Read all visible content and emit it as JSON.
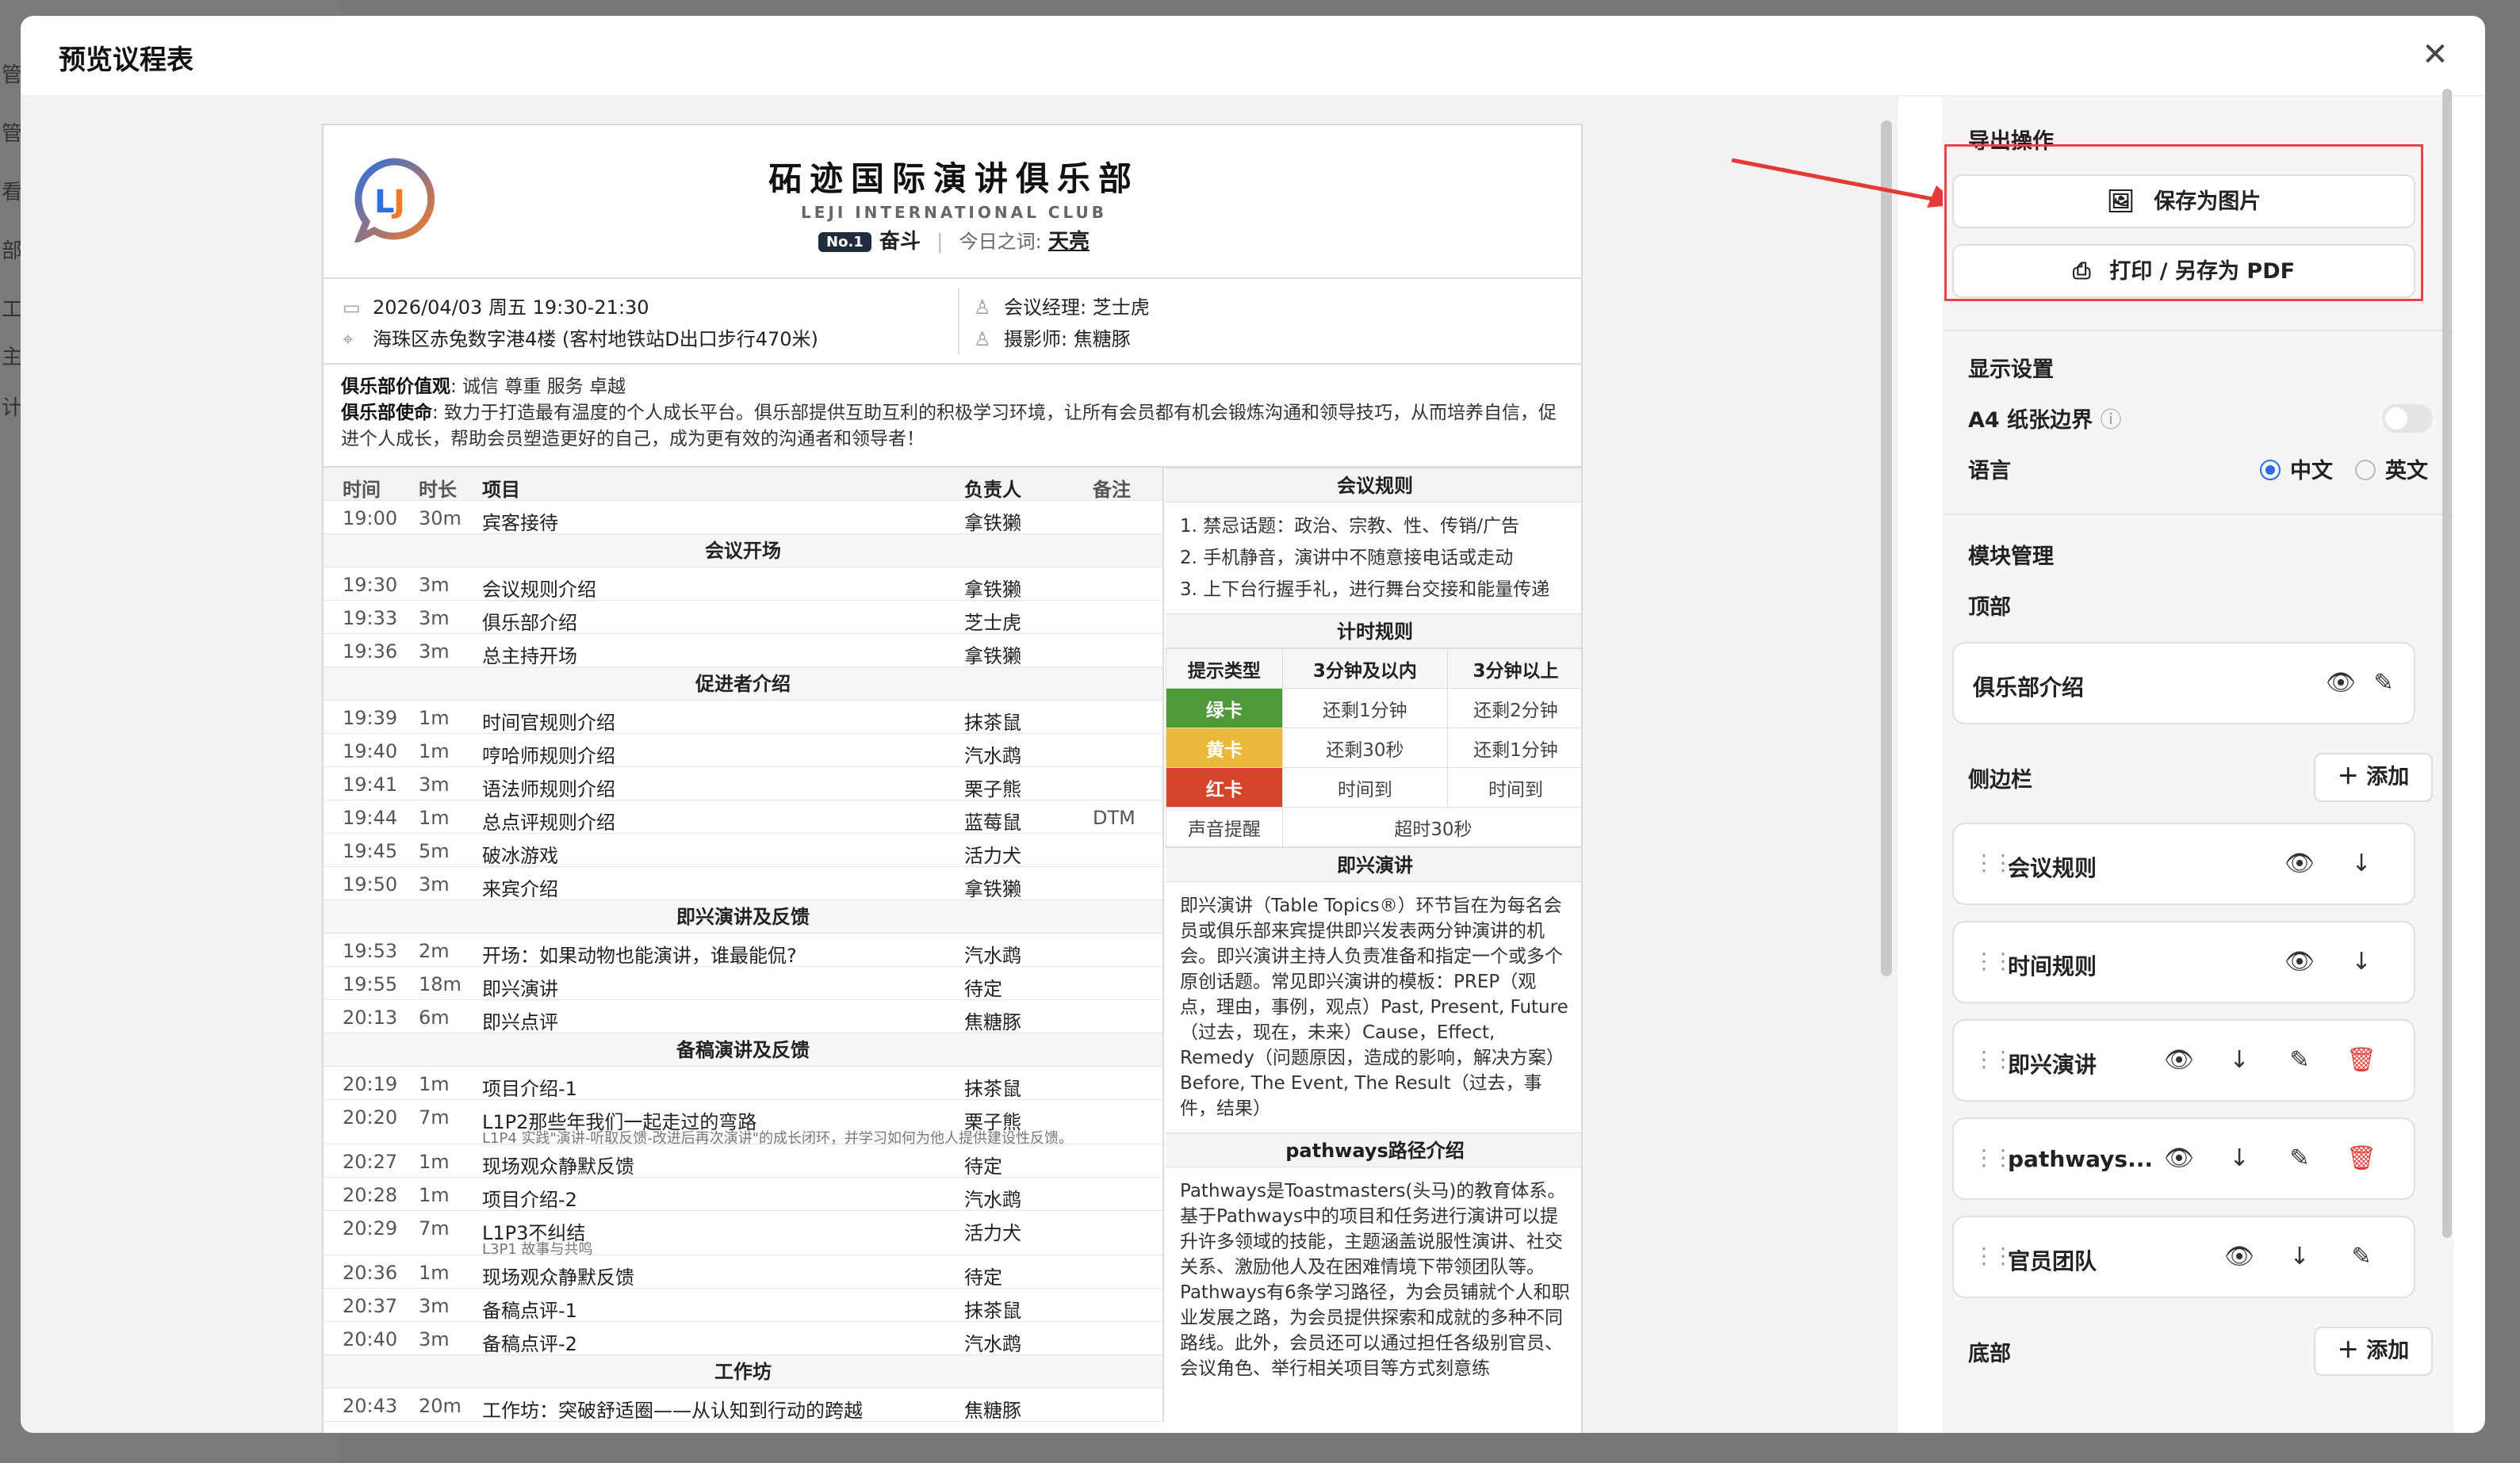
{
  "background": {
    "sidebar_fragments": [
      "管",
      "管",
      "看",
      "部",
      "工",
      "主",
      "计"
    ]
  },
  "dialog": {
    "title": "预览议程表",
    "close_icon": "✕"
  },
  "paper": {
    "club_name": "砳迹国际演讲俱乐部",
    "club_subtitle": "LEJI INTERNATIONAL CLUB",
    "meeting_no": "No.1",
    "theme": "奋斗",
    "word_label": "今日之词:",
    "word": "天亮",
    "datetime": "2026/04/03 周五 19:30-21:30",
    "location": "海珠区赤兔数字港4楼 (客村地铁站D出口步行470米)",
    "manager_label": "会议经理:",
    "manager": "芝士虎",
    "photographer_label": "摄影师:",
    "photographer": "焦糖豚",
    "values_label": "俱乐部价值观",
    "values": ": 诚信 尊重 服务 卓越",
    "mission_label": "俱乐部使命",
    "mission": ": 致力于打造最有温度的个人成长平台。俱乐部提供互助互利的积极学习环境，让所有会员都有机会锻炼沟通和领导技巧，从而培养自信，促进个人成长，帮助会员塑造更好的自己，成为更有效的沟通者和领导者！"
  },
  "agenda": {
    "headers": {
      "time": "时间",
      "duration": "时长",
      "item": "项目",
      "owner": "负责人",
      "note": "备注"
    },
    "rows": [
      {
        "type": "row",
        "time": "19:00",
        "dur": "30m",
        "item": "宾客接待",
        "owner": "拿铁獭",
        "note": ""
      },
      {
        "type": "section",
        "title": "会议开场"
      },
      {
        "type": "row",
        "time": "19:30",
        "dur": "3m",
        "item": "会议规则介绍",
        "owner": "拿铁獭",
        "note": ""
      },
      {
        "type": "row",
        "time": "19:33",
        "dur": "3m",
        "item": "俱乐部介绍",
        "owner": "芝士虎",
        "note": ""
      },
      {
        "type": "row",
        "time": "19:36",
        "dur": "3m",
        "item": "总主持开场",
        "owner": "拿铁獭",
        "note": ""
      },
      {
        "type": "section",
        "title": "促进者介绍"
      },
      {
        "type": "row",
        "time": "19:39",
        "dur": "1m",
        "item": "时间官规则介绍",
        "owner": "抹茶鼠",
        "note": ""
      },
      {
        "type": "row",
        "time": "19:40",
        "dur": "1m",
        "item": "哼哈师规则介绍",
        "owner": "汽水鹉",
        "note": ""
      },
      {
        "type": "row",
        "time": "19:41",
        "dur": "3m",
        "item": "语法师规则介绍",
        "owner": "栗子熊",
        "note": ""
      },
      {
        "type": "row",
        "time": "19:44",
        "dur": "1m",
        "item": "总点评规则介绍",
        "owner": "蓝莓鼠",
        "note": "DTM"
      },
      {
        "type": "row",
        "time": "19:45",
        "dur": "5m",
        "item": "破冰游戏",
        "owner": "活力犬",
        "note": ""
      },
      {
        "type": "row",
        "time": "19:50",
        "dur": "3m",
        "item": "来宾介绍",
        "owner": "拿铁獭",
        "note": ""
      },
      {
        "type": "section",
        "title": "即兴演讲及反馈"
      },
      {
        "type": "row",
        "time": "19:53",
        "dur": "2m",
        "item": "开场：如果动物也能演讲，谁最能侃?",
        "owner": "汽水鹉",
        "note": ""
      },
      {
        "type": "row",
        "time": "19:55",
        "dur": "18m",
        "item": "即兴演讲",
        "owner": "待定",
        "note": ""
      },
      {
        "type": "row",
        "time": "20:13",
        "dur": "6m",
        "item": "即兴点评",
        "owner": "焦糖豚",
        "note": ""
      },
      {
        "type": "section",
        "title": "备稿演讲及反馈"
      },
      {
        "type": "row",
        "time": "20:19",
        "dur": "1m",
        "item": "项目介绍-1",
        "owner": "抹茶鼠",
        "note": ""
      },
      {
        "type": "row2",
        "time": "20:20",
        "dur": "7m",
        "item": "L1P2那些年我们一起走过的弯路",
        "sub": "L1P4 实践\"演讲-听取反馈-改进后再次演讲\"的成长闭环，并学习如何为他人提供建设性反馈。",
        "owner": "栗子熊",
        "note": ""
      },
      {
        "type": "row",
        "time": "20:27",
        "dur": "1m",
        "item": "现场观众静默反馈",
        "owner": "待定",
        "note": ""
      },
      {
        "type": "row",
        "time": "20:28",
        "dur": "1m",
        "item": "项目介绍-2",
        "owner": "汽水鹉",
        "note": ""
      },
      {
        "type": "row2",
        "time": "20:29",
        "dur": "7m",
        "item": "L1P3不纠结",
        "sub": "L3P1 故事与共鸣",
        "owner": "活力犬",
        "note": ""
      },
      {
        "type": "row",
        "time": "20:36",
        "dur": "1m",
        "item": "现场观众静默反馈",
        "owner": "待定",
        "note": ""
      },
      {
        "type": "row",
        "time": "20:37",
        "dur": "3m",
        "item": "备稿点评-1",
        "owner": "抹茶鼠",
        "note": ""
      },
      {
        "type": "row",
        "time": "20:40",
        "dur": "3m",
        "item": "备稿点评-2",
        "owner": "汽水鹉",
        "note": ""
      },
      {
        "type": "section",
        "title": "工作坊"
      },
      {
        "type": "row",
        "time": "20:43",
        "dur": "20m",
        "item": "工作坊：突破舒适圈——从认知到行动的跨越",
        "owner": "焦糖豚",
        "note": ""
      }
    ]
  },
  "rules": {
    "meeting_rules_title": "会议规则",
    "meeting_rules": [
      "1. 禁忌话题：政治、宗教、性、传销/广告",
      "2. 手机静音，演讲中不随意接电话或走动",
      "3. 上下台行握手礼，进行舞台交接和能量传递"
    ],
    "timing_title": "计时规则",
    "timing_header": [
      "提示类型",
      "3分钟及以内",
      "3分钟以上"
    ],
    "timing_rows": [
      {
        "card": "绿卡",
        "a": "还剩1分钟",
        "b": "还剩2分钟",
        "color": "#4e9a3a"
      },
      {
        "card": "黄卡",
        "a": "还剩30秒",
        "b": "还剩1分钟",
        "color": "#e9b93b"
      },
      {
        "card": "红卡",
        "a": "时间到",
        "b": "时间到",
        "color": "#d8442a"
      }
    ],
    "sound_label": "声音提醒",
    "sound_value": "超时30秒",
    "impromptu_title": "即兴演讲",
    "impromptu_text": "即兴演讲（Table Topics®）环节旨在为每名会员或俱乐部来宾提供即兴发表两分钟演讲的机会。即兴演讲主持人负责准备和指定一个或多个原创话题。常见即兴演讲的模板：PREP（观点，理由，事例，观点）Past, Present, Future（过去，现在，未来）Cause，Effect, Remedy（问题原因，造成的影响，解决方案）Before, The Event, The Result（过去，事件，结果）",
    "pathways_title": "pathways路径介绍",
    "pathways_text": "Pathways是Toastmasters(头马)的教育体系。基于Pathways中的项目和任务进行演讲可以提升许多领域的技能，主题涵盖说服性演讲、社交关系、激励他人及在困难情境下带领团队等。Pathways有6条学习路径，为会员铺就个人和职业发展之路，为会员提供探索和成就的多种不同路线。此外，会员还可以通过担任各级别官员、会议角色、举行相关项目等方式刻意练"
  },
  "side": {
    "export_title": "导出操作",
    "save_image": "保存为图片",
    "print_pdf": "打印 / 另存为 PDF",
    "display_title": "显示设置",
    "a4_label": "A4 纸张边界",
    "a4_enabled": false,
    "lang_label": "语言",
    "lang_cn": "中文",
    "lang_en": "英文",
    "lang_selected": "中文",
    "modules_title": "模块管理",
    "top_label": "顶部",
    "top_modules": [
      "俱乐部介绍"
    ],
    "sidebar_label": "侧边栏",
    "add_label": "添加",
    "side_modules": [
      "会议规则",
      "时间规则",
      "即兴演讲",
      "pathways...",
      "官员团队"
    ],
    "bottom_label": "底部"
  }
}
